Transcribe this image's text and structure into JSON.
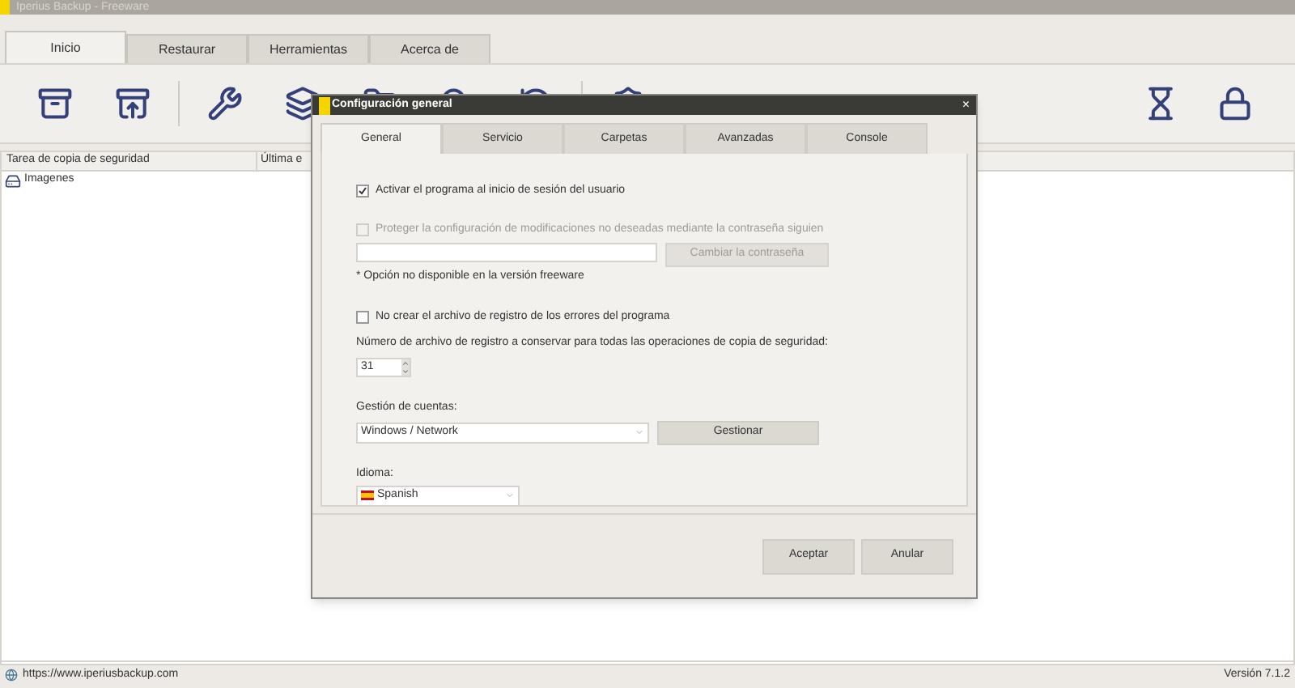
{
  "window": {
    "title": "Iperius Backup - Freeware"
  },
  "tabs": [
    {
      "label": "Inicio",
      "selected": true
    },
    {
      "label": "Restaurar",
      "selected": false
    },
    {
      "label": "Herramientas",
      "selected": false
    },
    {
      "label": "Acerca de",
      "selected": false
    }
  ],
  "table": {
    "columns": [
      "Tarea de copia de seguridad",
      "Última e"
    ],
    "rows": [
      {
        "name": "Imagenes"
      }
    ]
  },
  "dialog": {
    "title": "Configuración general",
    "close": "×",
    "tabs": [
      {
        "label": "General",
        "selected": true
      },
      {
        "label": "Servicio",
        "selected": false
      },
      {
        "label": "Carpetas",
        "selected": false
      },
      {
        "label": "Avanzadas",
        "selected": false
      },
      {
        "label": "Console",
        "selected": false
      }
    ],
    "start_option": {
      "label": "Activar el programa al inicio de sesión del usuario",
      "checked": true,
      "disabled": false
    },
    "protect_option": {
      "label": "Proteger la configuración de modificaciones no deseadas mediante la contraseña siguien",
      "checked": false,
      "disabled": true
    },
    "password_button": {
      "label": "Cambiar la contraseña",
      "disabled": true
    },
    "freeware_note": "* Opción no disponible en la versión freeware",
    "log_option": {
      "label": "No crear el archivo de registro de los errores del programa",
      "checked": false,
      "disabled": false
    },
    "log_count": {
      "label": "Número de archivo de registro a conservar para todas las operaciones de copia de seguridad:",
      "value": "31"
    },
    "accounts": {
      "label": "Gestión de cuentas:",
      "value": "Windows / Network",
      "button": "Gestionar"
    },
    "language": {
      "label": "Idioma:",
      "value": "Spanish"
    },
    "buttons": [
      "Aceptar",
      "Anular"
    ]
  },
  "status_bar": {
    "url": "https://www.iperiusbackup.com",
    "version": "Versión 7.1.2"
  }
}
